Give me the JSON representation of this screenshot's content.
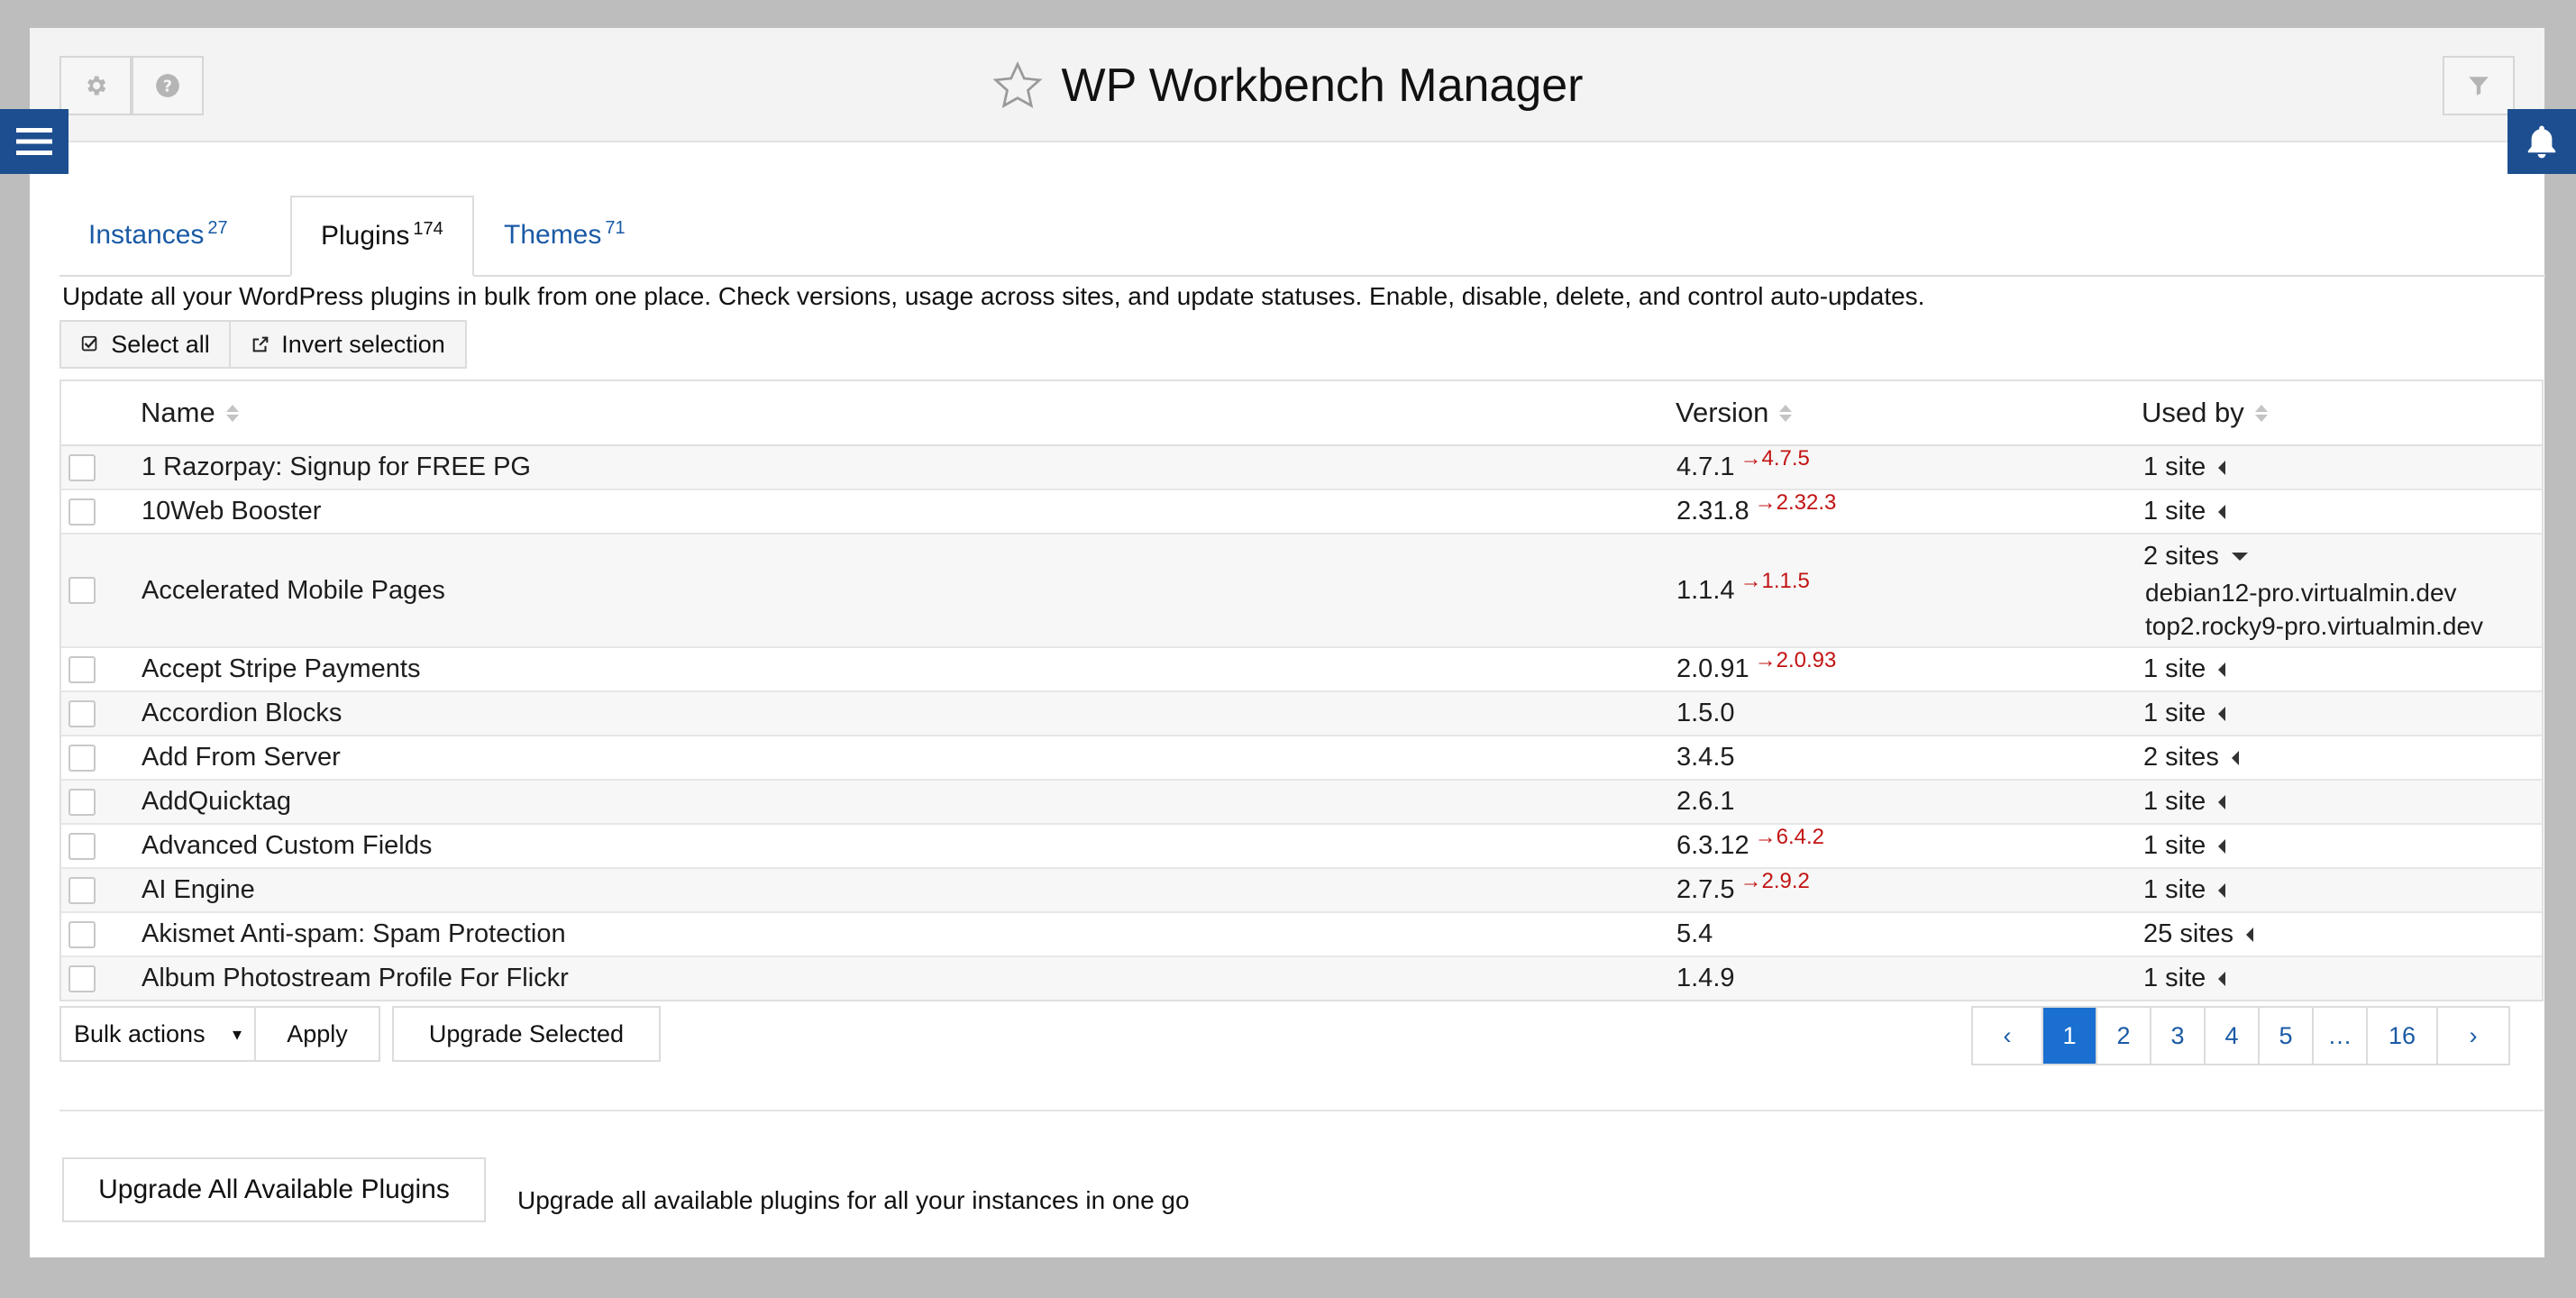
{
  "app": {
    "title": "WP Workbench Manager"
  },
  "tabs": [
    {
      "label": "Instances",
      "count": "27"
    },
    {
      "label": "Plugins",
      "count": "174"
    },
    {
      "label": "Themes",
      "count": "71"
    }
  ],
  "description": "Update all your WordPress plugins in bulk from one place. Check versions, usage across sites, and update statuses. Enable, disable, delete, and control auto-updates.",
  "selection": {
    "select_all": "Select all",
    "invert": "Invert selection"
  },
  "columns": {
    "name": "Name",
    "version": "Version",
    "used_by": "Used by"
  },
  "rows": [
    {
      "name": "1 Razorpay: Signup for FREE PG",
      "version": "4.7.1",
      "update": "→4.7.5",
      "used_by": "1 site"
    },
    {
      "name": "10Web Booster",
      "version": "2.31.8",
      "update": "→2.32.3",
      "used_by": "1 site"
    },
    {
      "name": "Accelerated Mobile Pages",
      "version": "1.1.4",
      "update": "→1.1.5",
      "used_by": "2 sites",
      "sites": [
        "debian12-pro.virtualmin.dev",
        "top2.rocky9-pro.virtualmin.dev"
      ]
    },
    {
      "name": "Accept Stripe Payments",
      "version": "2.0.91",
      "update": "→2.0.93",
      "used_by": "1 site"
    },
    {
      "name": "Accordion Blocks",
      "version": "1.5.0",
      "update": "",
      "used_by": "1 site"
    },
    {
      "name": "Add From Server",
      "version": "3.4.5",
      "update": "",
      "used_by": "2 sites"
    },
    {
      "name": "AddQuicktag",
      "version": "2.6.1",
      "update": "",
      "used_by": "1 site"
    },
    {
      "name": "Advanced Custom Fields",
      "version": "6.3.12",
      "update": "→6.4.2",
      "used_by": "1 site"
    },
    {
      "name": "AI Engine",
      "version": "2.7.5",
      "update": "→2.9.2",
      "used_by": "1 site"
    },
    {
      "name": "Akismet Anti-spam: Spam Protection",
      "version": "5.4",
      "update": "",
      "used_by": "25 sites"
    },
    {
      "name": "Album Photostream Profile For Flickr",
      "version": "1.4.9",
      "update": "",
      "used_by": "1 site"
    }
  ],
  "bulk": {
    "select_label": "Bulk actions",
    "apply": "Apply",
    "upgrade_selected": "Upgrade Selected"
  },
  "pagination": {
    "prev": "‹",
    "pages": [
      "1",
      "2",
      "3",
      "4",
      "5",
      "…",
      "16"
    ],
    "next": "›",
    "current": "1"
  },
  "footer": {
    "upgrade_all": "Upgrade All Available Plugins",
    "upgrade_all_desc": "Upgrade all available plugins for all your instances in one go"
  },
  "colors": {
    "accent": "#1a6fd0",
    "side_tab": "#1d4e8f",
    "update": "#c21313",
    "link": "#1a5aa5"
  }
}
